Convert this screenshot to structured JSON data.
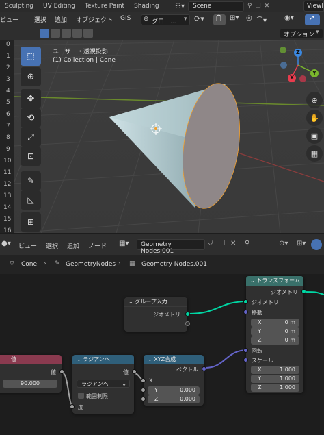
{
  "topbar": {
    "tabs": [
      "Sculpting",
      "UV Editing",
      "Texture Paint",
      "Shading"
    ],
    "scene": "Scene",
    "view_layer": "ViewL"
  },
  "viewport_header": {
    "menus": [
      "ビュー",
      "選択",
      "追加",
      "オブジェクト",
      "GIS"
    ],
    "orientation": "グロー...",
    "options": "オプション"
  },
  "viewport": {
    "view_name": "ユーザー・透視投影",
    "collection": "(1) Collection | Cone",
    "ruler": [
      "0",
      "1",
      "2",
      "3",
      "4",
      "5",
      "6",
      "7",
      "8",
      "9",
      "10",
      "11",
      "12",
      "13",
      "14",
      "15",
      "16"
    ],
    "gizmo": {
      "x": "X",
      "y": "Y",
      "z": "Z"
    },
    "colors": {
      "x": "#e83c4e",
      "y": "#7ab82d",
      "z": "#3b88e0",
      "active_tool": "#4772b3"
    }
  },
  "node_header": {
    "menus": [
      "ビュー",
      "選択",
      "追加",
      "ノード"
    ],
    "tree_name": "Geometry Nodes.001"
  },
  "breadcrumb": [
    "Cone",
    "GeometryNodes",
    "Geometry Nodes.001"
  ],
  "nodes": {
    "group_input": {
      "title": "グループ入力",
      "output": "ジオメトリ"
    },
    "transform": {
      "title": "トランスフォーム",
      "output": "ジオメトリ",
      "geometry": "ジオメトリ",
      "translation": "移動:",
      "tx_label": "X",
      "tx": "0 m",
      "ty_label": "Y",
      "ty": "0 m",
      "tz_label": "Z",
      "tz": "0 m",
      "rotation": "回転",
      "scale": "スケール:",
      "sx_label": "X",
      "sx": "1.000",
      "sy_label": "Y",
      "sy": "1.000",
      "sz_label": "Z",
      "sz": "1.000"
    },
    "value": {
      "title": "値",
      "output": "値",
      "value": "90.000"
    },
    "radians": {
      "title": "ラジアンへ",
      "output": "値",
      "mode": "ラジアンへ",
      "clamp": "範囲制限",
      "input": "度"
    },
    "combine_xyz": {
      "title": "XYZ合成",
      "output": "ベクトル",
      "x": "X",
      "y_label": "Y",
      "y": "0.000",
      "z_label": "Z",
      "z": "0.000"
    }
  }
}
